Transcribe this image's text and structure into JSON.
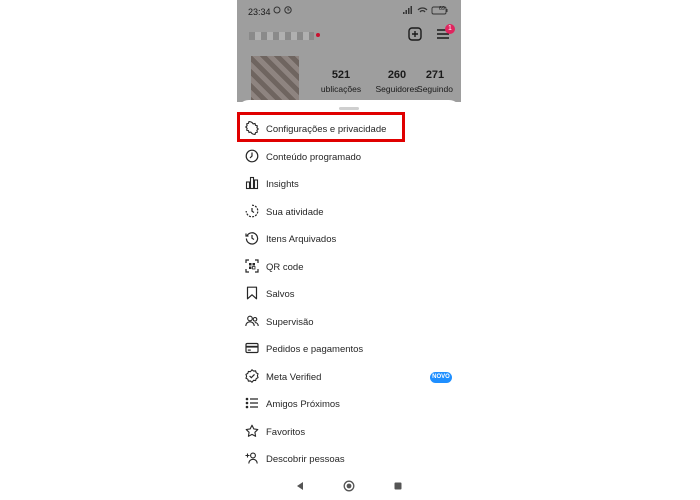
{
  "status_bar": {
    "time": "23:34",
    "battery": "69"
  },
  "profile": {
    "notifications_badge": "1",
    "stats": [
      {
        "value": "521",
        "label": "publicações",
        "visible_label": "ublicações"
      },
      {
        "value": "260",
        "label": "Seguidores"
      },
      {
        "value": "271",
        "label": "Seguindo"
      }
    ]
  },
  "menu": {
    "items": [
      {
        "label": "Configurações e privacidade",
        "icon": "gear-icon",
        "highlighted": true
      },
      {
        "label": "Conteúdo programado",
        "icon": "clock-icon"
      },
      {
        "label": "Insights",
        "icon": "bar-chart-icon"
      },
      {
        "label": "Sua atividade",
        "icon": "activity-icon"
      },
      {
        "label": "Itens Arquivados",
        "icon": "archive-history-icon"
      },
      {
        "label": "QR code",
        "icon": "qr-code-icon"
      },
      {
        "label": "Salvos",
        "icon": "bookmark-icon"
      },
      {
        "label": "Supervisão",
        "icon": "supervision-icon"
      },
      {
        "label": "Pedidos e pagamentos",
        "icon": "credit-card-icon"
      },
      {
        "label": "Meta Verified",
        "icon": "verified-badge-icon",
        "badge": "NOVO"
      },
      {
        "label": "Amigos Próximos",
        "icon": "list-icon"
      },
      {
        "label": "Favoritos",
        "icon": "star-icon"
      },
      {
        "label": "Descobrir pessoas",
        "icon": "add-person-icon"
      }
    ]
  },
  "colors": {
    "highlight": "#e00000",
    "badge_blue": "#1f8fff",
    "notification_red": "#e0245e"
  }
}
